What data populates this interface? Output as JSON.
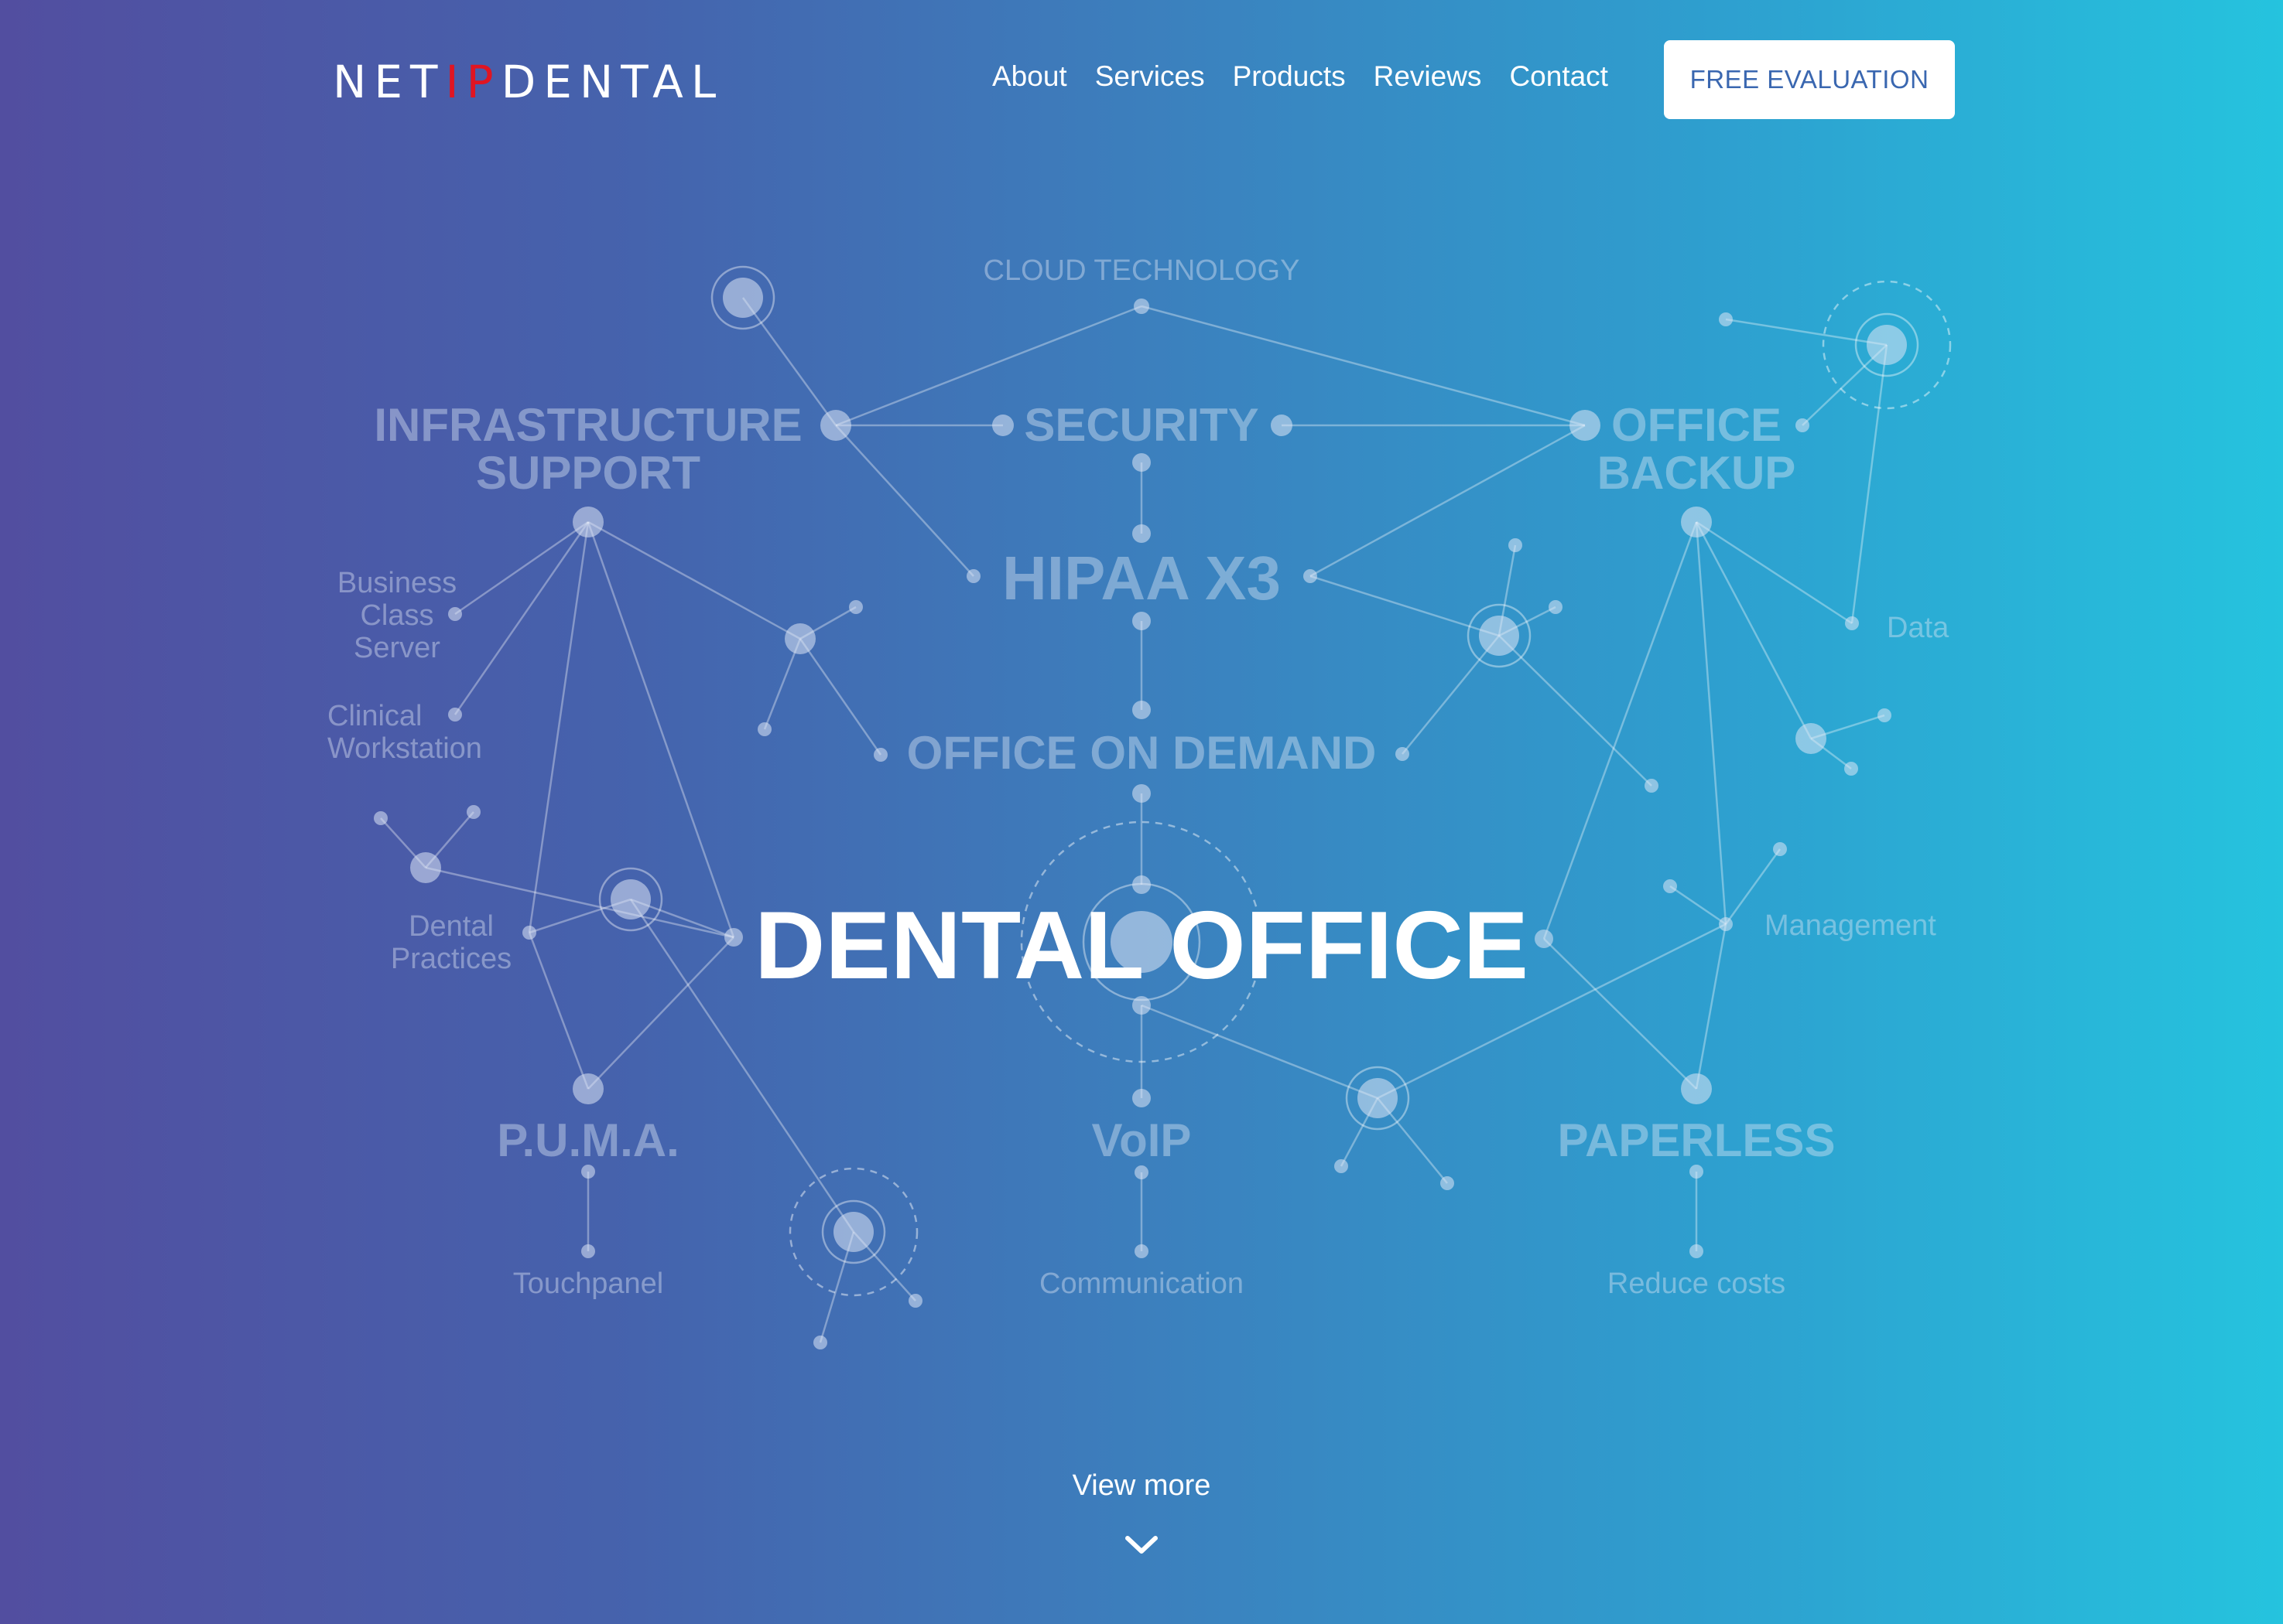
{
  "header": {
    "logo": {
      "part1": "NET",
      "part2": "IP",
      "part3": "DENTAL"
    },
    "nav": [
      "About",
      "Services",
      "Products",
      "Reviews",
      "Contact"
    ],
    "cta_label": "FREE EVALUATION"
  },
  "network": {
    "cloud": "CLOUD TECHNOLOGY",
    "infra_line1": "INFRASTRUCTURE",
    "infra_line2": "SUPPORT",
    "security": "SECURITY",
    "backup_line1": "OFFICE",
    "backup_line2": "BACKUP",
    "hipaa": "HIPAA X3",
    "demand": "OFFICE ON DEMAND",
    "server_line1": "Business",
    "server_line2": "Class",
    "server_line3": "Server",
    "workstation_line1": "Clinical",
    "workstation_line2": "Workstation",
    "data": "Data",
    "practices_line1": "Dental",
    "practices_line2": "Practices",
    "management": "Management",
    "puma": "P.U.M.A.",
    "voip": "VoIP",
    "paperless": "PAPERLESS",
    "touchpanel": "Touchpanel",
    "communication": "Communication",
    "reduce": "Reduce costs"
  },
  "hero": {
    "title": "DENTAL OFFICE"
  },
  "footer": {
    "view_more": "View more",
    "view_more_icon": "chevron-down-icon"
  },
  "colors": {
    "accent": "#e01522",
    "gradient_start": "#524ea0",
    "gradient_end": "#25c3de",
    "cta_text": "#3a67b0"
  }
}
